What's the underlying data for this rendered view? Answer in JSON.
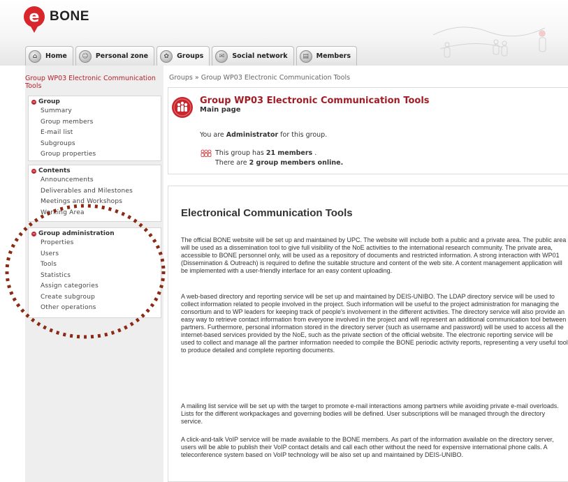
{
  "app": {
    "logo_text": "BONE",
    "logo_letter": "e",
    "brand_color": "#d8262c"
  },
  "nav": {
    "tabs": [
      {
        "label": "Home",
        "icon": "home-icon"
      },
      {
        "label": "Personal zone",
        "icon": "person-icon"
      },
      {
        "label": "Groups",
        "icon": "groups-icon"
      },
      {
        "label": "Social network",
        "icon": "network-icon"
      },
      {
        "label": "Members",
        "icon": "members-icon"
      }
    ]
  },
  "sidebar": {
    "title": "Group WP03 Electronic Communication Tools",
    "sections": [
      {
        "heading": "Group",
        "items": [
          "Summary",
          "Group members",
          "E-mail list",
          "Subgroups",
          "Group properties"
        ]
      },
      {
        "heading": "Contents",
        "items": [
          "Announcements",
          "Deliverables and Milestones",
          "Meetings and Workshops",
          "Working Area"
        ]
      },
      {
        "heading": "Group administration",
        "items": [
          "Properties",
          "Users",
          "Tools",
          "Statistics",
          "Assign categories",
          "Create subgroup",
          "Other operations"
        ]
      }
    ]
  },
  "breadcrumb": "Groups » Group WP03 Electronic Communication Tools",
  "group": {
    "title": "Group WP03 Electronic Communication Tools",
    "subtitle": "Main page",
    "admin_prefix": "You are ",
    "admin_role": "Administrator",
    "admin_suffix": " for this group.",
    "members_prefix": "This group has ",
    "members_count": "21 members",
    "members_suffix": " .",
    "online_prefix": "There are ",
    "online_count": "2 group members online."
  },
  "article": {
    "title": "Electronical Communication Tools",
    "paragraphs": [
      "The official BONE website will be set up and maintained by UPC. The website will include both a public and a private area. The public area will be used as a dissemination tool to give full visibility of the NoE activities to the international research community. The private area, accessible to BONE personnel only, will be used as a repository of documents and restricted information. A strong interaction with WP01 (Dissemination & Outreach) is required to define the suitable structure and content of the web site. A content management application will be implemented with a user-friendly interface for an easy content uploading.",
      "A web-based directory and reporting service will be set up and maintained by DEIS-UNIBO. The LDAP directory service will be used to collect information related to people involved in the project. Such information will be useful to the project administration for managing the consortium and to WP leaders for keeping track of people's involvement in the different activities. The directory service will also provide an easy way to retrieve contact information from everyone involved in the project and will represent an additional communication tool between partners. Furthermore, personal information stored in the directory server (such as username and password) will be used to access all the internet-based services provided by the NoE, such as the private section of the official website. The electronic reporting service will be used to collect and manage all the partner information needed to compile the BONE periodic activity reports, representing a very useful tool to produce detailed and complete reporting documents.",
      "A mailing list service will be set up with the target to promote e-mail interactions among partners while avoiding private e-mail overloads. Lists for the different workpackages and governing bodies will be defined. User subscriptions will be managed through the directory service.",
      "A click-and-talk VoIP service will be made available to the BONE members. As part of the information available on the directory server, users will be able to publish their VoIP contact details and call each other without the need for expensive international phone calls. A teleconference system based on VoIP technology will be also set up and maintained by DEIS-UNIBO."
    ]
  },
  "colors": {
    "accent": "#b3222a",
    "annotation": "#8b2a14",
    "sidebar_bg": "#eeeeee"
  }
}
